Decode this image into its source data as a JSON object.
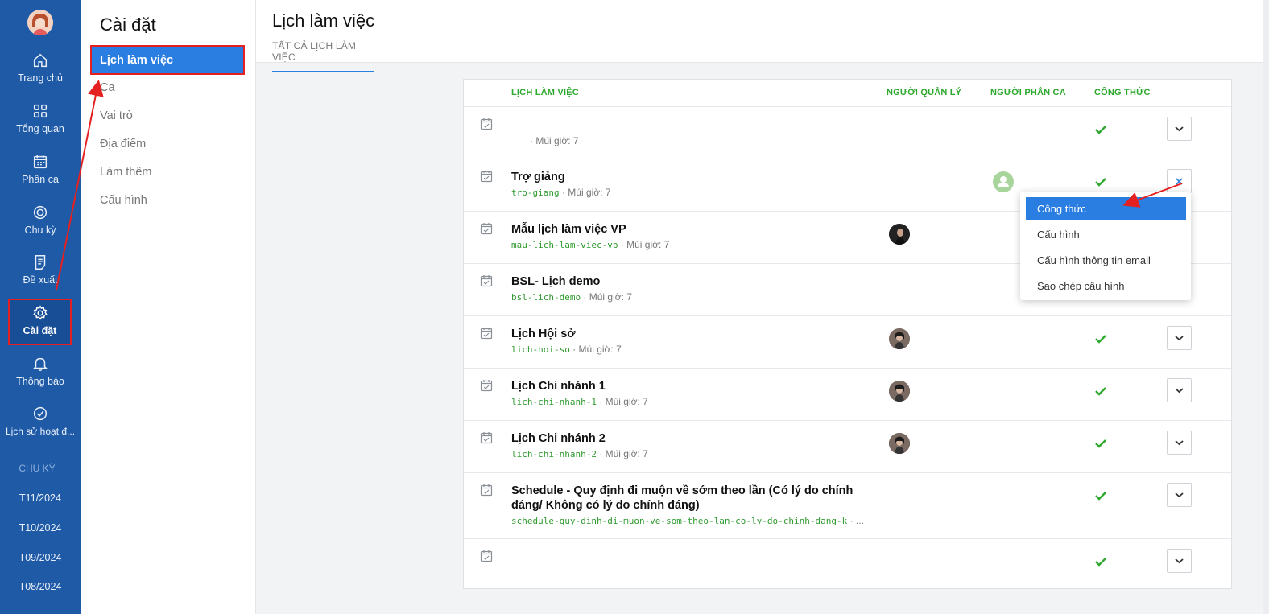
{
  "nav": {
    "items": [
      {
        "label": "Trang chủ",
        "icon": "home-icon"
      },
      {
        "label": "Tổng quan",
        "icon": "grid-icon"
      },
      {
        "label": "Phân ca",
        "icon": "calendar-icon"
      },
      {
        "label": "Chu kỳ",
        "icon": "cycle-icon"
      },
      {
        "label": "Đề xuất",
        "icon": "document-icon"
      },
      {
        "label": "Cài đặt",
        "icon": "gear-icon"
      },
      {
        "label": "Thông báo",
        "icon": "bell-icon"
      },
      {
        "label": "Lịch sử hoạt đ...",
        "icon": "check-circle-icon"
      }
    ],
    "section_label": "CHU KỲ",
    "periods": [
      "T11/2024",
      "T10/2024",
      "T09/2024",
      "T08/2024"
    ]
  },
  "settings": {
    "title": "Cài đặt",
    "items": [
      "Lịch làm việc",
      "Ca",
      "Vai trò",
      "Địa điểm",
      "Làm thêm",
      "Cấu hình"
    ]
  },
  "main": {
    "title": "Lịch làm việc",
    "tab": "TẤT CẢ LỊCH LÀM VIỆC"
  },
  "table": {
    "headers": [
      "LỊCH LÀM VIỆC",
      "NGƯỜI QUẢN LÝ",
      "NGƯỜI PHÂN CA",
      "CÔNG THỨC"
    ],
    "rows": [
      {
        "name": "",
        "slug": "",
        "tz": "· Múi giờ: 7",
        "manager": false,
        "assigner": false,
        "formula": true
      },
      {
        "name": "Trợ giảng",
        "slug": "tro-giang",
        "tz": " · Múi giờ: 7",
        "manager": false,
        "assigner": true,
        "formula": true
      },
      {
        "name": "Mẫu lịch làm việc VP",
        "slug": "mau-lich-lam-viec-vp",
        "tz": " · Múi giờ: 7",
        "manager": true,
        "assigner": false,
        "formula": false
      },
      {
        "name": "BSL- Lịch demo",
        "slug": "bsl-lich-demo",
        "tz": " · Múi giờ: 7",
        "manager": false,
        "assigner": false,
        "formula": false
      },
      {
        "name": "Lịch Hội sở",
        "slug": "lich-hoi-so",
        "tz": " · Múi giờ: 7",
        "manager": true,
        "assigner": false,
        "formula": true
      },
      {
        "name": "Lịch Chi nhánh 1",
        "slug": "lich-chi-nhanh-1",
        "tz": " · Múi giờ: 7",
        "manager": true,
        "assigner": false,
        "formula": true
      },
      {
        "name": "Lịch Chi nhánh 2",
        "slug": "lich-chi-nhanh-2",
        "tz": " · Múi giờ: 7",
        "manager": true,
        "assigner": false,
        "formula": true
      },
      {
        "name": "Schedule - Quy định đi muộn về sớm theo lần (Có lý do chính đáng/ Không có lý do chính đáng)",
        "slug": "schedule-quy-dinh-di-muon-ve-som-theo-lan-co-ly-do-chinh-dang-k",
        "tz": " · ...",
        "manager": false,
        "assigner": false,
        "formula": true
      },
      {
        "name": "",
        "slug": "",
        "tz": "",
        "manager": false,
        "assigner": false,
        "formula": true
      }
    ]
  },
  "menu": {
    "items": [
      "Công thức",
      "Cấu hình",
      "Cấu hình thông tin email",
      "Sao chép cấu hình"
    ]
  },
  "colors": {
    "nav_bg": "#1f5aa6",
    "accent": "#2a7de1",
    "green": "#2ea82e",
    "annotation_red": "#e52020"
  }
}
